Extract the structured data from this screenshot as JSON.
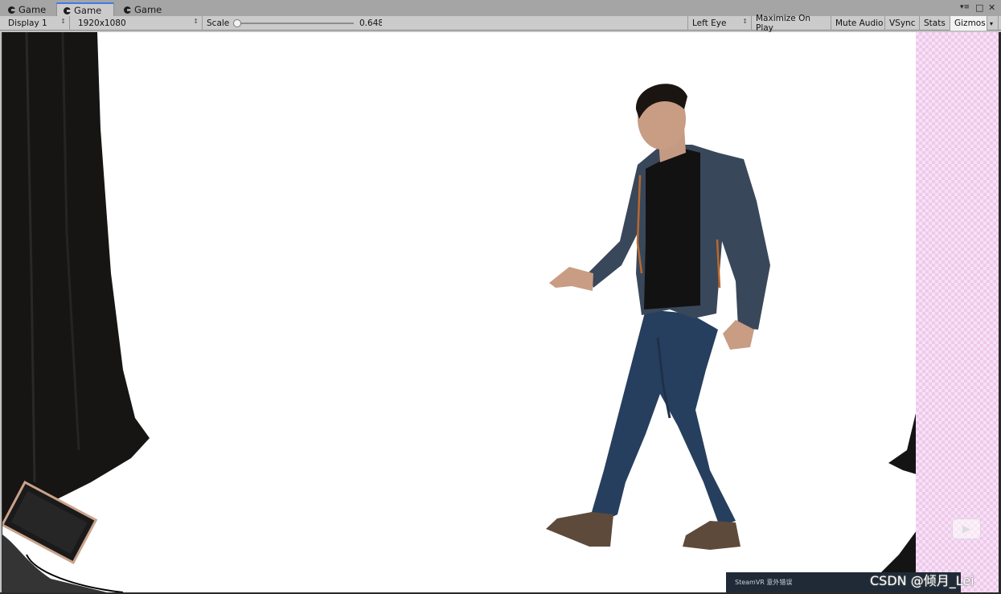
{
  "tabs": [
    {
      "label": "Game",
      "active": false
    },
    {
      "label": "Game",
      "active": true
    },
    {
      "label": "Game",
      "active": false
    }
  ],
  "window_controls": {
    "menu": "▾≡",
    "maximize": "□",
    "close": "✕"
  },
  "toolbar": {
    "display": "Display 1",
    "resolution": "1920x1080",
    "scale_label": "Scale",
    "scale_value": "0.648",
    "eye": "Left Eye",
    "maximize_on_play": "Maximize On Play",
    "mute_audio": "Mute Audio",
    "vsync": "VSync",
    "stats": "Stats",
    "gizmos": "Gizmos"
  },
  "overlay": {
    "play_icon": "▶",
    "toast_text": "SteamVR 意外错误",
    "watermark": "CSDN @倾月_Lei"
  },
  "colors": {
    "active_tab_accent": "#3e7ce7",
    "toolbar_bg": "#cbcbcb",
    "viewport_bg": "#ffffff",
    "checker_pink": "#efc8ec"
  }
}
